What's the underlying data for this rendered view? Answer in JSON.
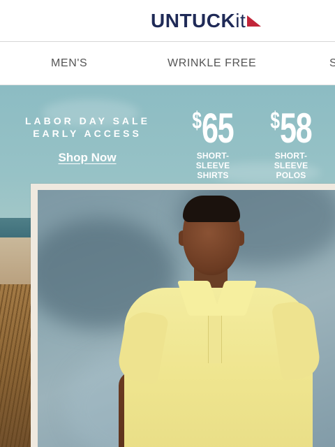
{
  "header": {
    "brand_main": "UNTUCK",
    "brand_it": "it",
    "flag_icon": "red-triangle-flag",
    "brand_color": "#1f2a57",
    "flag_color": "#c2263a"
  },
  "nav": {
    "items": [
      "MEN'S",
      "WRINKLE FREE",
      "S"
    ]
  },
  "hero": {
    "promo_line1": "LABOR DAY SALE",
    "promo_line2": "EARLY ACCESS",
    "cta_label": "Shop Now",
    "offers": [
      {
        "dollar": "$",
        "amount": "65",
        "caption": "SHORT-SLEEVE\nSHIRTS"
      },
      {
        "dollar": "$",
        "amount": "58",
        "caption": "SHORT-SLEEVE\nPOLOS"
      }
    ]
  }
}
